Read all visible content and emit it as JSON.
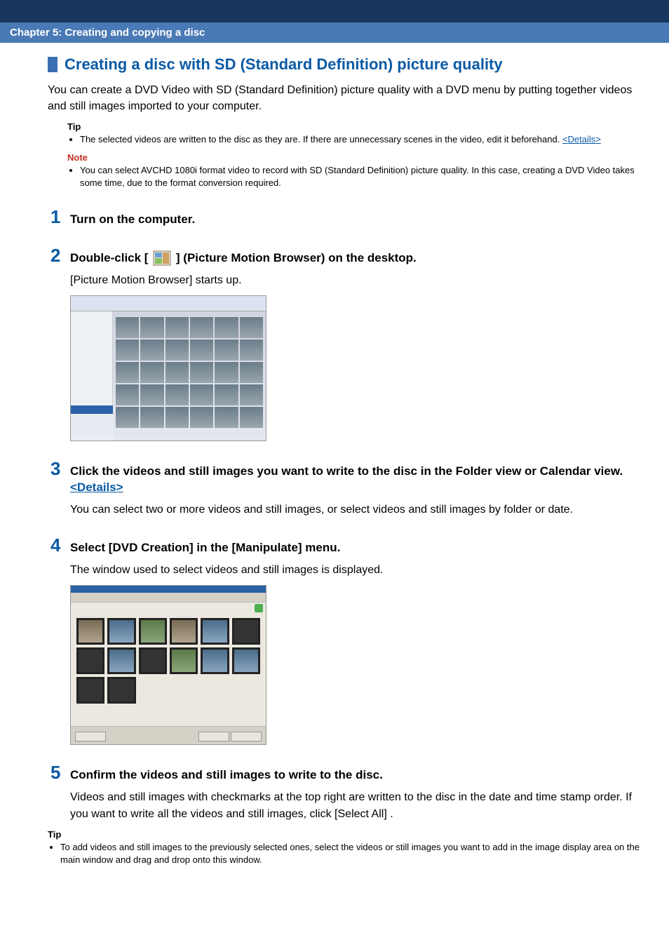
{
  "chapter": "Chapter 5: Creating and copying a disc",
  "title": "Creating a disc with SD (Standard Definition) picture quality",
  "intro": "You can create a DVD Video with SD (Standard Definition) picture quality with a DVD menu by putting together videos and still images imported to your computer.",
  "tip_label": "Tip",
  "note_label": "Note",
  "tip1_text": "The selected videos are written to the disc as they are. If there are unnecessary scenes in the video, edit it beforehand. ",
  "details_link": "<Details>",
  "note1_text": "You can select AVCHD 1080i format video to record with SD (Standard Definition) picture quality. In this case, creating a DVD Video takes some time, due to the format conversion required.",
  "steps": {
    "s1": {
      "num": "1",
      "title": "Turn on the computer."
    },
    "s2": {
      "num": "2",
      "title_prefix": "Double-click [ ",
      "title_suffix": " ] (Picture Motion Browser) on the desktop.",
      "body": "[Picture Motion Browser] starts up."
    },
    "s3": {
      "num": "3",
      "title_prefix": "Click the videos and still images you want to write to the disc in the Folder view or Calendar view. ",
      "body": "You can select two or more videos and still images, or select videos and still images by folder or date."
    },
    "s4": {
      "num": "4",
      "title": "Select [DVD Creation] in the [Manipulate] menu.",
      "body": "The window used to select videos and still images is displayed."
    },
    "s5": {
      "num": "5",
      "title": "Confirm the videos and still images to write to the disc.",
      "body": "Videos and still images with checkmarks at the top right are written to the disc in the date and time stamp order. If you want to write all the videos and still images, click [Select All] ."
    }
  },
  "tip2_text": "To add videos and still images to the previously selected ones, select the videos or still images you want to add in the image display area on the main window and drag and drop onto this window."
}
